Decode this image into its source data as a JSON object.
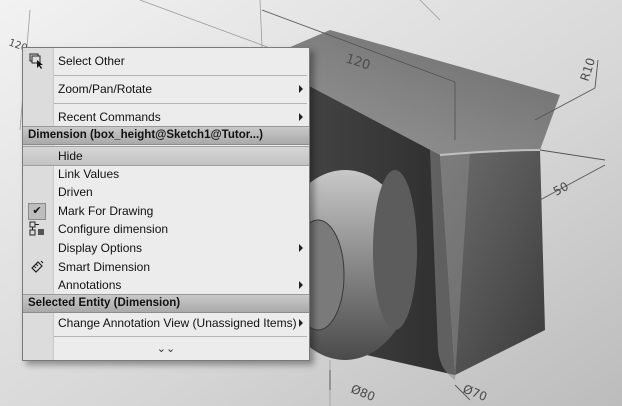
{
  "viewport": {
    "dim_120_left": "120",
    "dim_120_top": "120",
    "dim_r10": "R10",
    "dim_50": "50",
    "dim_d80": "Ø80",
    "dim_d70": "Ø70"
  },
  "menu": {
    "top_items": [
      {
        "label": "Select Other",
        "icon": "select-other-icon",
        "submenu": false
      },
      {
        "label": "Zoom/Pan/Rotate",
        "submenu": true
      },
      {
        "label": "Recent Commands",
        "submenu": true
      }
    ],
    "dimension_header": "Dimension (box_height@Sketch1@Tutor...)",
    "dimension_items": [
      {
        "label": "Hide",
        "highlighted": true
      },
      {
        "label": "Link Values"
      },
      {
        "label": "Driven"
      },
      {
        "label": "Mark For Drawing",
        "checked": true
      },
      {
        "label": "Configure dimension",
        "icon": "configure-dimension-icon"
      },
      {
        "label": "Display Options",
        "submenu": true
      },
      {
        "label": "Smart Dimension",
        "icon": "smart-dimension-icon"
      },
      {
        "label": "Annotations",
        "submenu": true
      }
    ],
    "entity_header": "Selected Entity (Dimension)",
    "entity_items": [
      {
        "label": "Change Annotation View (Unassigned Items)",
        "submenu": true
      }
    ],
    "expand_glyph": "⌄⌄"
  }
}
